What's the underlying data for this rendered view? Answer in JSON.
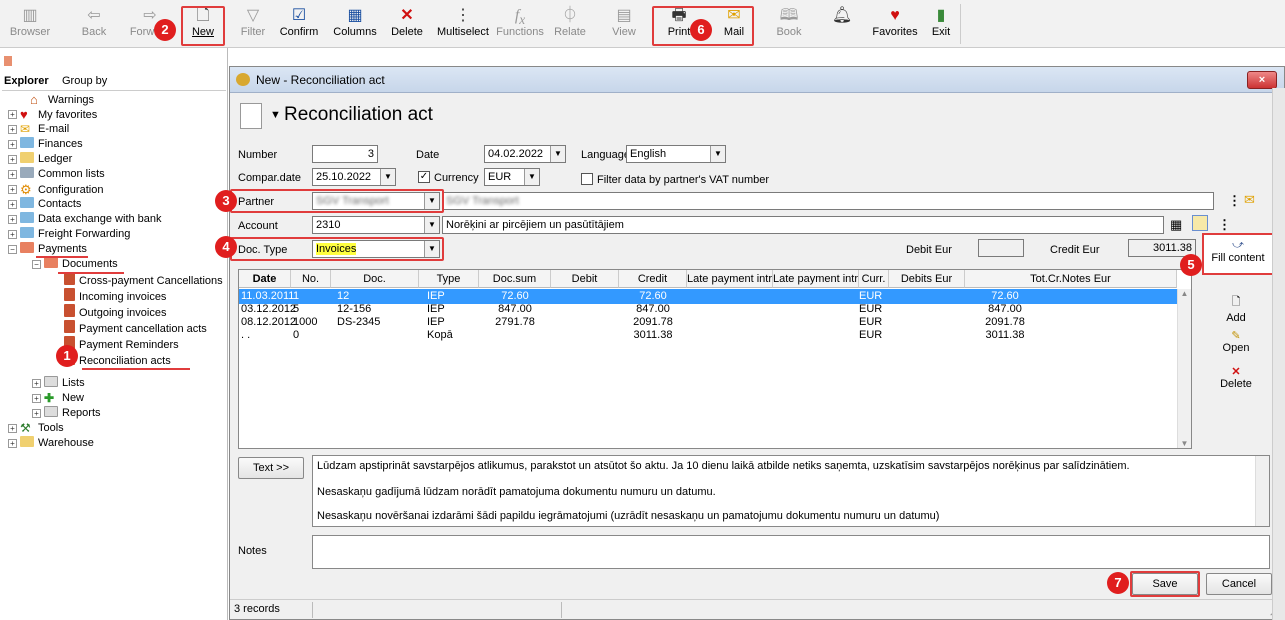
{
  "toolbar": {
    "items": [
      {
        "label": "Browser"
      },
      {
        "label": "Back"
      },
      {
        "label": "Forward"
      },
      {
        "label": "New"
      },
      {
        "label": "Filter"
      },
      {
        "label": "Confirm"
      },
      {
        "label": "Columns"
      },
      {
        "label": "Delete"
      },
      {
        "label": "Multiselect"
      },
      {
        "label": "Functions"
      },
      {
        "label": "Relate"
      },
      {
        "label": "View"
      },
      {
        "label": "Print"
      },
      {
        "label": "Mail"
      },
      {
        "label": "Book"
      },
      {
        "label": ""
      },
      {
        "label": "Favorites"
      },
      {
        "label": "Exit"
      }
    ]
  },
  "badges": [
    "1",
    "2",
    "3",
    "4",
    "5",
    "6",
    "7"
  ],
  "sidebar": {
    "header": {
      "explorer": "Explorer",
      "group_by": "Group by"
    },
    "items": [
      {
        "label": "Warnings"
      },
      {
        "label": "My favorites"
      },
      {
        "label": "E-mail"
      },
      {
        "label": "Finances"
      },
      {
        "label": "Ledger"
      },
      {
        "label": "Common lists"
      },
      {
        "label": "Configuration"
      },
      {
        "label": "Contacts"
      },
      {
        "label": "Data exchange with bank"
      },
      {
        "label": "Freight Forwarding"
      },
      {
        "label": "Payments"
      },
      {
        "label": "Documents"
      },
      {
        "label": "Cross-payment Cancellations"
      },
      {
        "label": "Incoming invoices"
      },
      {
        "label": "Outgoing invoices"
      },
      {
        "label": "Payment cancellation acts"
      },
      {
        "label": "Payment Reminders"
      },
      {
        "label": "Reconciliation acts"
      },
      {
        "label": "Lists"
      },
      {
        "label": "New"
      },
      {
        "label": "Reports"
      },
      {
        "label": "Tools"
      },
      {
        "label": "Warehouse"
      }
    ]
  },
  "dialog": {
    "window_title": "New - Reconciliation act",
    "heading": "Reconciliation act",
    "close_symbol": "×",
    "form": {
      "number_label": "Number",
      "number_value": "3",
      "date_label": "Date",
      "date_value": "04.02.2022",
      "language_label": "Language",
      "language_value": "English",
      "compar_date_label": "Compar.date",
      "compar_date_value": "25.10.2022",
      "currency_label": "Currency",
      "currency_value": "EUR",
      "filter_vat_label": "Filter data by partner's VAT number",
      "partner_label": "Partner",
      "partner_value": "SGV Transport",
      "partner_name_value": "SGV Transport",
      "account_label": "Account",
      "account_value": "2310",
      "account_name_value": "Norēķini ar pircējiem un pasūtītājiem",
      "doc_type_label": "Doc. Type",
      "doc_type_value": "Invoices",
      "debit_label": "Debit Eur",
      "debit_value": "",
      "credit_label": "Credit Eur",
      "credit_value": "3011.38"
    },
    "side_buttons": {
      "fill_content": "Fill content",
      "add": "Add",
      "open": "Open",
      "delete": "Delete"
    },
    "table": {
      "columns": [
        "Date",
        "No.",
        "Doc.",
        "Type",
        "Doc.sum",
        "Debit",
        "Credit",
        "Late payment intr.",
        "Late payment intr.c.",
        "Curr.",
        "Debits Eur",
        "Tot.Cr.Notes Eur"
      ],
      "rows": [
        {
          "date": "11.03.2011",
          "no": "1",
          "doc": "12",
          "type": "IEP",
          "docsum": "72.60",
          "debit": "",
          "credit": "72.60",
          "curr": "EUR",
          "debits_eur": "",
          "tot": "72.60"
        },
        {
          "date": "03.12.2012",
          "no": "5",
          "doc": "12-156",
          "type": "IEP",
          "docsum": "847.00",
          "debit": "",
          "credit": "847.00",
          "curr": "EUR",
          "debits_eur": "",
          "tot": "847.00"
        },
        {
          "date": "08.12.2012",
          "no": "1000",
          "doc": "DS-2345",
          "type": "IEP",
          "docsum": "2791.78",
          "debit": "",
          "credit": "2091.78",
          "curr": "EUR",
          "debits_eur": "",
          "tot": "2091.78"
        },
        {
          "date": ". .",
          "no": "0",
          "doc": "",
          "type": "Kopā",
          "docsum": "",
          "debit": "",
          "credit": "3011.38",
          "curr": "EUR",
          "debits_eur": "",
          "tot": "3011.38"
        }
      ]
    },
    "text_button": "Text >>",
    "text_lines": [
      "Lūdzam apstiprināt savstarpējos atlikumus, parakstot un atsūtot šo aktu. Ja 10 dienu laikā atbilde netiks saņemta, uzskatīsim savstarpējos norēķinus par salīdzinātiem.",
      "Nesaskaņu gadījumā lūdzam norādīt pamatojuma dokumentu numuru un datumu.",
      "Nesaskaņu novēršanai izdarāmi šādi papildu iegrāmatojumi (uzrādīt nesaskaņu un pamatojumu dokumentu numuru un datumu)"
    ],
    "notes_label": "Notes",
    "save_label": "Save",
    "cancel_label": "Cancel",
    "status_records": "3 records"
  }
}
